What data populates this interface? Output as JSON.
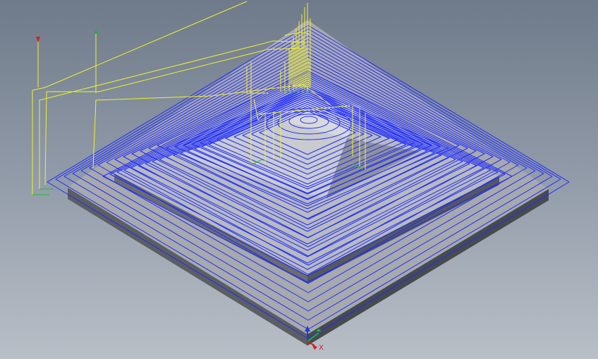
{
  "viewport": {
    "background_top": "#6f7a8a",
    "background_bottom": "#b9bfc7"
  },
  "colors": {
    "toolpath_cut": "#1f2cff",
    "toolpath_rapid": "#f1f12a",
    "toolpath_link": "#1fbf3a",
    "stock_top": "#a7a9ad",
    "stock_side_left": "#5c5e62",
    "stock_side_right": "#474a4f",
    "axis_x": "#d61f1f",
    "axis_y": "#1bb33a",
    "axis_z": "#1f3ad6"
  },
  "triad": {
    "x_label": "X",
    "x_icon": "x-axis-arrow-icon",
    "y_icon": "y-axis-arrow-icon",
    "z_icon": "z-axis-arrow-icon"
  },
  "markers": {
    "left_red_icon": "red-arrow-marker-icon",
    "left_green_icon": "green-arrow-marker-icon"
  }
}
